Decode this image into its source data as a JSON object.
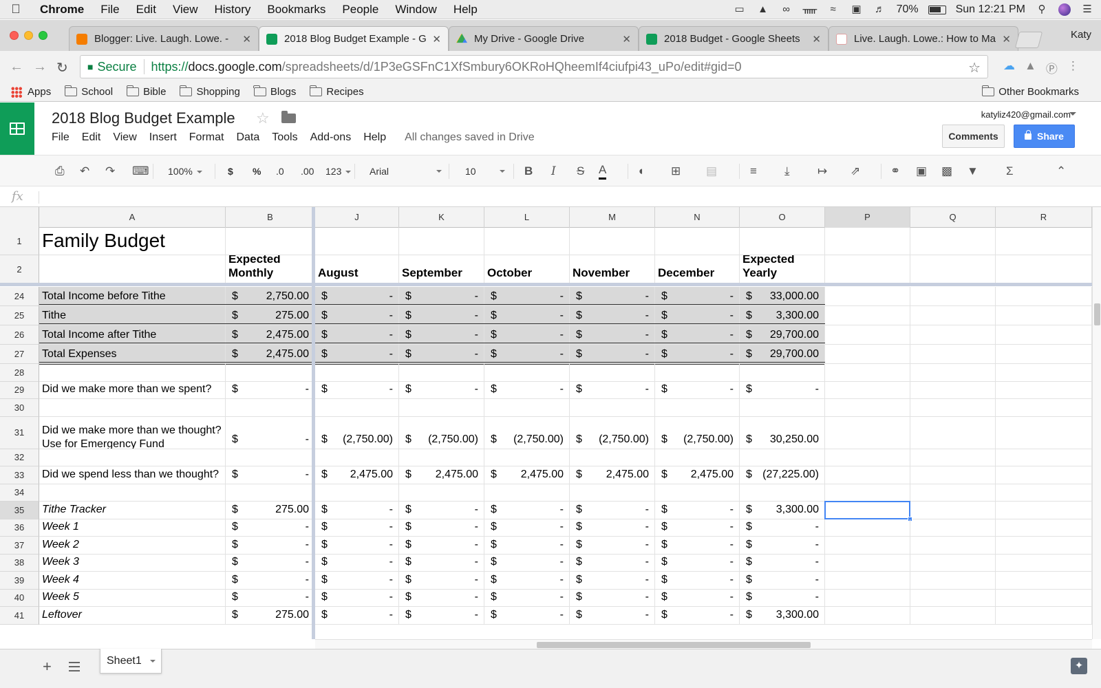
{
  "mac_menu": {
    "app": "Chrome",
    "items": [
      "File",
      "Edit",
      "View",
      "History",
      "Bookmarks",
      "People",
      "Window",
      "Help"
    ],
    "battery": "70%",
    "clock": "Sun 12:21 PM"
  },
  "tabs": [
    {
      "title": "Blogger: Live. Laugh. Lowe. -",
      "icon": "blogger-icon",
      "active": false
    },
    {
      "title": "2018 Blog Budget Example - G",
      "icon": "sheets-icon",
      "active": true
    },
    {
      "title": "My Drive - Google Drive",
      "icon": "drive-icon",
      "active": false
    },
    {
      "title": "2018 Budget - Google Sheets",
      "icon": "sheets-icon",
      "active": false
    },
    {
      "title": "Live. Laugh. Lowe.: How to Ma",
      "icon": "post-icon",
      "active": false
    }
  ],
  "profile_name": "Katy",
  "address": {
    "secure_label": "Secure",
    "scheme": "https://",
    "host": "docs.google.com",
    "path": "/spreadsheets/d/1P3eGSFnC1XfSmbury6OKRoHQheemIf4ciufpi43_uPo/edit#gid=0"
  },
  "bookmarks": {
    "apps": "Apps",
    "folders": [
      "School",
      "Bible",
      "Shopping",
      "Blogs",
      "Recipes"
    ],
    "other": "Other Bookmarks"
  },
  "sheets": {
    "title": "2018 Blog Budget Example",
    "menu": [
      "File",
      "Edit",
      "View",
      "Insert",
      "Format",
      "Data",
      "Tools",
      "Add-ons",
      "Help"
    ],
    "saved_status": "All changes saved in Drive",
    "account": "katyliz420@gmail.com",
    "comments_label": "Comments",
    "share_label": "Share",
    "toolbar": {
      "zoom": "100%",
      "currency": "$",
      "percent": "%",
      "dec_less": ".0",
      "dec_more": ".00",
      "more_formats": "123",
      "font": "Arial",
      "font_size": "10",
      "bold": "B",
      "italic": "I",
      "strike": "S",
      "text_color": "A"
    },
    "fx": "fx",
    "sheet_tab": "Sheet1"
  },
  "grid": {
    "columns": [
      "A",
      "B",
      "J",
      "K",
      "L",
      "M",
      "N",
      "O",
      "P",
      "Q",
      "R"
    ],
    "selected_column": "P",
    "selected_row": "35",
    "title_cell": "Family Budget",
    "header_cells": {
      "B": "Expected Monthly",
      "J": "August",
      "K": "September",
      "L": "October",
      "M": "November",
      "N": "December",
      "O": "Expected Yearly"
    },
    "rows": [
      {
        "num": "24",
        "label": "Total Income before Tithe",
        "style": "shaded",
        "values": [
          "2,750.00",
          "-",
          "-",
          "-",
          "-",
          "-",
          "33,000.00"
        ]
      },
      {
        "num": "25",
        "label": "Tithe",
        "style": "shaded",
        "values": [
          "275.00",
          "-",
          "-",
          "-",
          "-",
          "-",
          "3,300.00"
        ]
      },
      {
        "num": "26",
        "label": "Total Income after Tithe",
        "style": "shaded",
        "values": [
          "2,475.00",
          "-",
          "-",
          "-",
          "-",
          "-",
          "29,700.00"
        ]
      },
      {
        "num": "27",
        "label": "Total Expenses",
        "style": "shaded",
        "values": [
          "2,475.00",
          "-",
          "-",
          "-",
          "-",
          "-",
          "29,700.00"
        ]
      },
      {
        "num": "28",
        "label": "",
        "style": "blank",
        "values": []
      },
      {
        "num": "29",
        "label": "Did we make more than we spent?",
        "style": "normal",
        "values": [
          "-",
          "-",
          "-",
          "-",
          "-",
          "-",
          "-"
        ]
      },
      {
        "num": "30",
        "label": "",
        "style": "blank",
        "values": []
      },
      {
        "num": "31",
        "label": "Did we make more than we thought? Use for Emergency Fund",
        "style": "tall",
        "values": [
          "-",
          "(2,750.00)",
          "(2,750.00)",
          "(2,750.00)",
          "(2,750.00)",
          "(2,750.00)",
          "30,250.00"
        ]
      },
      {
        "num": "32",
        "label": "",
        "style": "blank",
        "values": []
      },
      {
        "num": "33",
        "label": "Did we spend less than we thought?",
        "style": "normal",
        "values": [
          "-",
          "2,475.00",
          "2,475.00",
          "2,475.00",
          "2,475.00",
          "2,475.00",
          "(27,225.00)"
        ]
      },
      {
        "num": "34",
        "label": "",
        "style": "blank",
        "values": []
      },
      {
        "num": "35",
        "label": "Tithe Tracker",
        "style": "italic",
        "values": [
          "275.00",
          "-",
          "-",
          "-",
          "-",
          "-",
          "3,300.00"
        ]
      },
      {
        "num": "36",
        "label": "Week 1",
        "style": "italic",
        "values": [
          "-",
          "-",
          "-",
          "-",
          "-",
          "-",
          "-"
        ]
      },
      {
        "num": "37",
        "label": "Week 2",
        "style": "italic",
        "values": [
          "-",
          "-",
          "-",
          "-",
          "-",
          "-",
          "-"
        ]
      },
      {
        "num": "38",
        "label": "Week 3",
        "style": "italic",
        "values": [
          "-",
          "-",
          "-",
          "-",
          "-",
          "-",
          "-"
        ]
      },
      {
        "num": "39",
        "label": "Week 4",
        "style": "italic",
        "values": [
          "-",
          "-",
          "-",
          "-",
          "-",
          "-",
          "-"
        ]
      },
      {
        "num": "40",
        "label": "Week 5",
        "style": "italic",
        "values": [
          "-",
          "-",
          "-",
          "-",
          "-",
          "-",
          "-"
        ]
      },
      {
        "num": "41",
        "label": "Leftover",
        "style": "italic",
        "values": [
          "275.00",
          "-",
          "-",
          "-",
          "-",
          "-",
          "3,300.00"
        ]
      }
    ],
    "currency_symbol": "$"
  },
  "colors": {
    "sheets_green": "#0f9d58",
    "share_blue": "#4a8af4",
    "selection_blue": "#4285f4",
    "shaded_row": "#d9d9d9"
  }
}
